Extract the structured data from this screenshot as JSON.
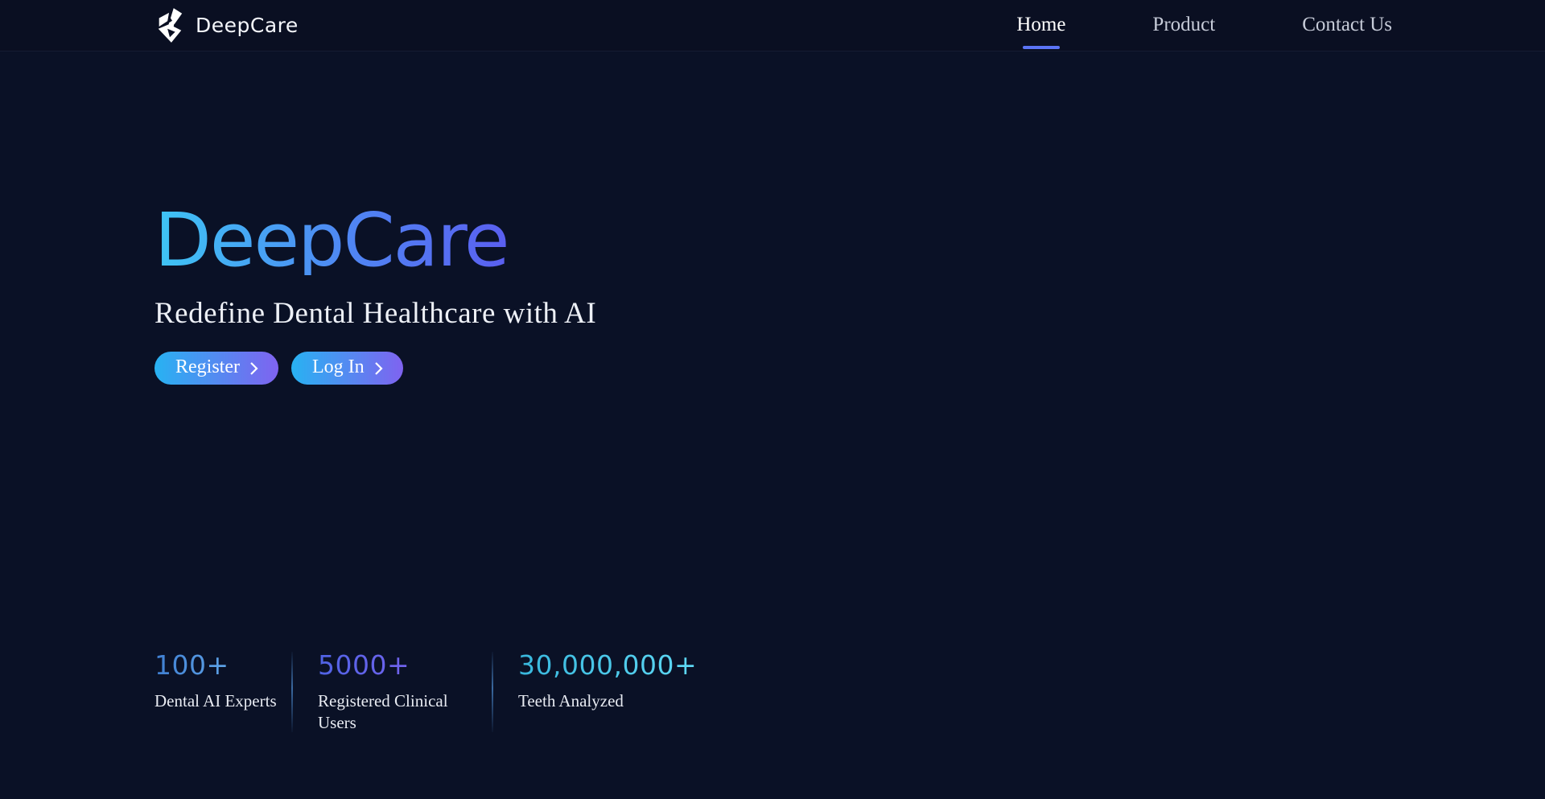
{
  "brand": {
    "name": "DeepCare"
  },
  "nav": {
    "items": [
      {
        "label": "Home",
        "active": true
      },
      {
        "label": "Product",
        "active": false
      },
      {
        "label": "Contact Us",
        "active": false
      }
    ]
  },
  "hero": {
    "title": "DeepCare",
    "subtitle": "Redefine Dental Healthcare with AI",
    "register_label": "Register",
    "login_label": "Log In"
  },
  "stats": [
    {
      "value": "100+",
      "label": "Dental AI Experts"
    },
    {
      "value": "5000+",
      "label": "Registered Clinical Users"
    },
    {
      "value": "30,000,000+",
      "label": "Teeth Analyzed"
    }
  ],
  "icons": {
    "logo": "deepcare-tooth-mark",
    "button_arrow": "chevron-right"
  },
  "colors": {
    "bg": "#0a1126",
    "navbg": "#0a0f22",
    "underline": "#5b74f5",
    "titlestart": "#3ec5f4",
    "titlemid": "#4f86f3",
    "titleend": "#5a5ff0",
    "btnstart": "#28b2f2",
    "btnend": "#7f63f0",
    "stat1a": "#3f7fd2",
    "stat1b": "#5fa4e8",
    "stat2a": "#4f63e4",
    "stat2b": "#7263ee",
    "stat3a": "#38b7dd",
    "stat3b": "#5fd9f5",
    "divider": "#4a86c8"
  }
}
